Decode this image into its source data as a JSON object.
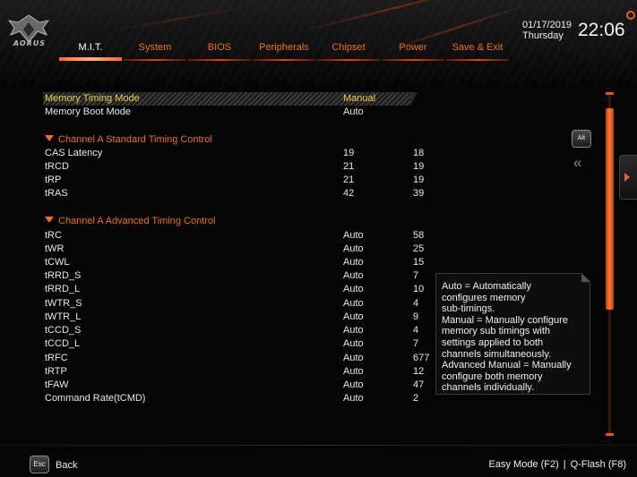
{
  "brand": {
    "logo_text": "AORUS"
  },
  "header": {
    "date": "01/17/2019",
    "weekday": "Thursday",
    "time": "22:06"
  },
  "tabs": [
    {
      "label": "M.I.T.",
      "active": true
    },
    {
      "label": "System"
    },
    {
      "label": "BIOS"
    },
    {
      "label": "Peripherals"
    },
    {
      "label": "Chipset"
    },
    {
      "label": "Power"
    },
    {
      "label": "Save & Exit"
    }
  ],
  "top_rows": [
    {
      "label": "Memory Timing Mode",
      "value": "Manual",
      "selected": true
    },
    {
      "label": "Memory Boot Mode",
      "value": "Auto"
    }
  ],
  "standard_section": {
    "title": "Channel A Standard Timing Control",
    "rows": [
      {
        "label": "CAS Latency",
        "value": "19",
        "current": "18"
      },
      {
        "label": "tRCD",
        "value": "21",
        "current": "19"
      },
      {
        "label": "tRP",
        "value": "21",
        "current": "19"
      },
      {
        "label": "tRAS",
        "value": "42",
        "current": "39"
      }
    ]
  },
  "advanced_section": {
    "title": "Channel A Advanced Timing Control",
    "rows": [
      {
        "label": "tRC",
        "value": "Auto",
        "current": "58"
      },
      {
        "label": "tWR",
        "value": "Auto",
        "current": "25"
      },
      {
        "label": "tCWL",
        "value": "Auto",
        "current": "15"
      },
      {
        "label": "tRRD_S",
        "value": "Auto",
        "current": "7"
      },
      {
        "label": "tRRD_L",
        "value": "Auto",
        "current": "10"
      },
      {
        "label": "tWTR_S",
        "value": "Auto",
        "current": "4"
      },
      {
        "label": "tWTR_L",
        "value": "Auto",
        "current": "9"
      },
      {
        "label": "tCCD_S",
        "value": "Auto",
        "current": "4"
      },
      {
        "label": "tCCD_L",
        "value": "Auto",
        "current": "7"
      },
      {
        "label": "tRFC",
        "value": "Auto",
        "current": "677"
      },
      {
        "label": "tRTP",
        "value": "Auto",
        "current": "12"
      },
      {
        "label": "tFAW",
        "value": "Auto",
        "current": "47"
      },
      {
        "label": "Command Rate(tCMD)",
        "value": "Auto",
        "current": "2"
      }
    ]
  },
  "help": {
    "lines": [
      "Auto = Automatically",
      "configures memory",
      "sub-timings.",
      "Manual = Manually configure",
      "memory sub timings with",
      "settings applied to both",
      "channels simultaneously.",
      "Advanced Manual = Manually",
      "configure both memory",
      "channels individually."
    ]
  },
  "side": {
    "alt_label": "Alt",
    "collapse_glyph": "«"
  },
  "footer": {
    "esc_label": "Esc",
    "back_label": "Back",
    "easy_mode": "Easy Mode (F2)",
    "separator": "|",
    "qflash": "Q-Flash (F8)"
  },
  "colors": {
    "accent": "#f07020",
    "selected_text": "#f5cc3a",
    "background": "#050505"
  },
  "icons": [
    "aorus-eagle-icon",
    "gear-icon",
    "alt-key-icon",
    "double-chevron-left-icon",
    "esc-key-icon",
    "expand-arrow-icon",
    "triangle-down-icon"
  ]
}
